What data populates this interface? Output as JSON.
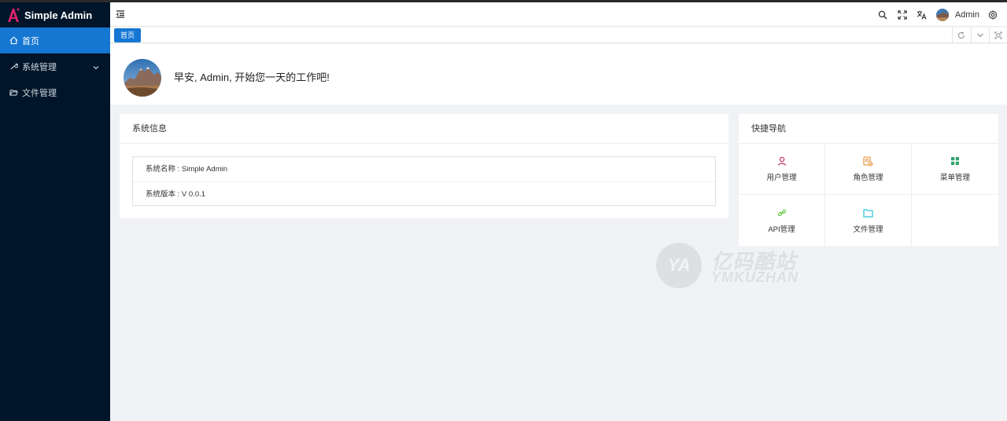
{
  "app": {
    "name": "Simple Admin"
  },
  "sidebar": {
    "items": [
      {
        "label": "首页",
        "icon": "home-icon",
        "active": true
      },
      {
        "label": "系统管理",
        "icon": "wrench-icon",
        "expandable": true
      },
      {
        "label": "文件管理",
        "icon": "folder-open-icon"
      }
    ]
  },
  "header": {
    "username": "Admin"
  },
  "tabs": [
    {
      "label": "首页",
      "active": true
    }
  ],
  "welcome": {
    "greeting": "早安, Admin, 开始您一天的工作吧!"
  },
  "system_info": {
    "title": "系统信息",
    "rows": [
      {
        "text": "系统名称 : Simple Admin"
      },
      {
        "text": "系统版本 : V 0.0.1"
      }
    ]
  },
  "quick_nav": {
    "title": "快捷导航",
    "items": [
      {
        "label": "用户管理",
        "icon": "user-icon",
        "color": "#c0335e"
      },
      {
        "label": "角色管理",
        "icon": "role-icon",
        "color": "#e08a2a"
      },
      {
        "label": "菜单管理",
        "icon": "menu-grid-icon",
        "color": "#2fa36b"
      },
      {
        "label": "API管理",
        "icon": "link-icon",
        "color": "#5cc63a"
      },
      {
        "label": "文件管理",
        "icon": "folder-icon",
        "color": "#2bc4d6"
      }
    ]
  },
  "watermark": {
    "mark": "YA",
    "line1": "亿码酷站",
    "line2": "YMKUZHAN"
  },
  "colors": {
    "sidebar_bg": "#001529",
    "accent": "#1677d3",
    "page_bg": "#f0f2f5"
  }
}
